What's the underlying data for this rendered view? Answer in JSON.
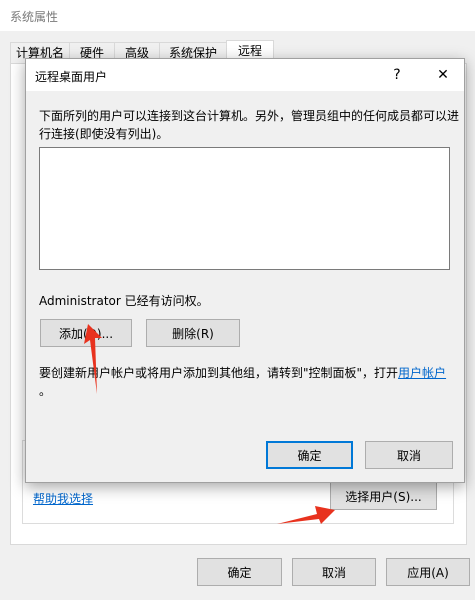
{
  "outer_dialog": {
    "title": "系统属性",
    "tabs": [
      {
        "label": "计算机名"
      },
      {
        "label": "硬件"
      },
      {
        "label": "高级"
      },
      {
        "label": "系统保护"
      },
      {
        "label": "远程"
      }
    ],
    "help_link": "帮助我选择",
    "select_users_button": "选择用户(S)...",
    "ok_button": "确定",
    "cancel_button": "取消",
    "apply_button": "应用(A)"
  },
  "inner_dialog": {
    "title": "远程桌面用户",
    "help_button": "?",
    "close_button": "✕",
    "description": "下面所列的用户可以连接到这台计算机。另外，管理员组中的任何成员都可以进行连接(即使没有列出)。",
    "access_text": "Administrator 已经有访问权。",
    "add_button": "添加(D)...",
    "remove_button": "删除(R)",
    "hint_text": "要创建新用户帐户或将用户添加到其他组，请转到\"控制面板\"，打开",
    "hint_link": "用户帐户",
    "hint_end": "。",
    "ok_button": "确定",
    "cancel_button": "取消"
  },
  "colors": {
    "accent": "#0078d7",
    "link": "#0066cc",
    "annotation_arrow": "#e8321e"
  }
}
